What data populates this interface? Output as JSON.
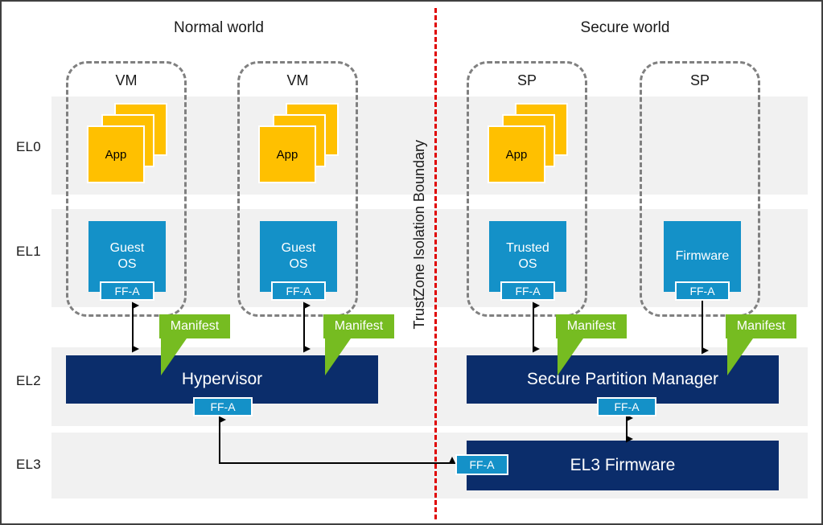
{
  "diagram": {
    "title": "Arm FF-A architecture: Normal world and Secure world exception levels",
    "worlds": [
      {
        "id": "normal",
        "label": "Normal world"
      },
      {
        "id": "secure",
        "label": "Secure world"
      }
    ],
    "boundary": {
      "label": "TrustZone Isolation Boundary",
      "color": "#E00000",
      "style": "dashed-vertical"
    },
    "exception_levels": [
      {
        "id": "el0",
        "label": "EL0"
      },
      {
        "id": "el1",
        "label": "EL1"
      },
      {
        "id": "el2",
        "label": "EL2"
      },
      {
        "id": "el3",
        "label": "EL3"
      }
    ],
    "partitions": [
      {
        "id": "vm1",
        "label": "VM",
        "world": "normal",
        "app_label": "App",
        "has_app_stack": true,
        "os_lines": [
          "Guest",
          "OS"
        ],
        "os_badge": "FF-A",
        "manifest_label": "Manifest",
        "arrow_to_manager": "double"
      },
      {
        "id": "vm2",
        "label": "VM",
        "world": "normal",
        "app_label": "App",
        "has_app_stack": true,
        "os_lines": [
          "Guest",
          "OS"
        ],
        "os_badge": "FF-A",
        "manifest_label": "Manifest",
        "arrow_to_manager": "double"
      },
      {
        "id": "sp1",
        "label": "SP",
        "world": "secure",
        "app_label": "App",
        "has_app_stack": true,
        "os_lines": [
          "Trusted",
          "OS"
        ],
        "os_badge": "FF-A",
        "manifest_label": "Manifest",
        "arrow_to_manager": "double"
      },
      {
        "id": "sp2",
        "label": "SP",
        "world": "secure",
        "app_label": "",
        "has_app_stack": false,
        "os_lines": [
          "Firmware"
        ],
        "os_badge": "FF-A",
        "manifest_label": "Manifest",
        "arrow_to_manager": "down"
      }
    ],
    "managers": [
      {
        "id": "hypervisor",
        "label": "Hypervisor",
        "level": "EL2",
        "world": "normal",
        "badge": "FF-A"
      },
      {
        "id": "spm",
        "label": "Secure Partition Manager",
        "level": "EL2",
        "world": "secure",
        "badge": "FF-A"
      },
      {
        "id": "el3fw",
        "label": "EL3 Firmware",
        "level": "EL3",
        "world": "secure",
        "badge": "FF-A"
      }
    ],
    "colors": {
      "app": "#FFC000",
      "os": "#1491C8",
      "manager": "#0B2D6B",
      "manifest": "#76BC21",
      "band": "#F1F1F1",
      "partition_border": "#808080",
      "boundary": "#E00000",
      "outer_border": "#404040"
    }
  }
}
